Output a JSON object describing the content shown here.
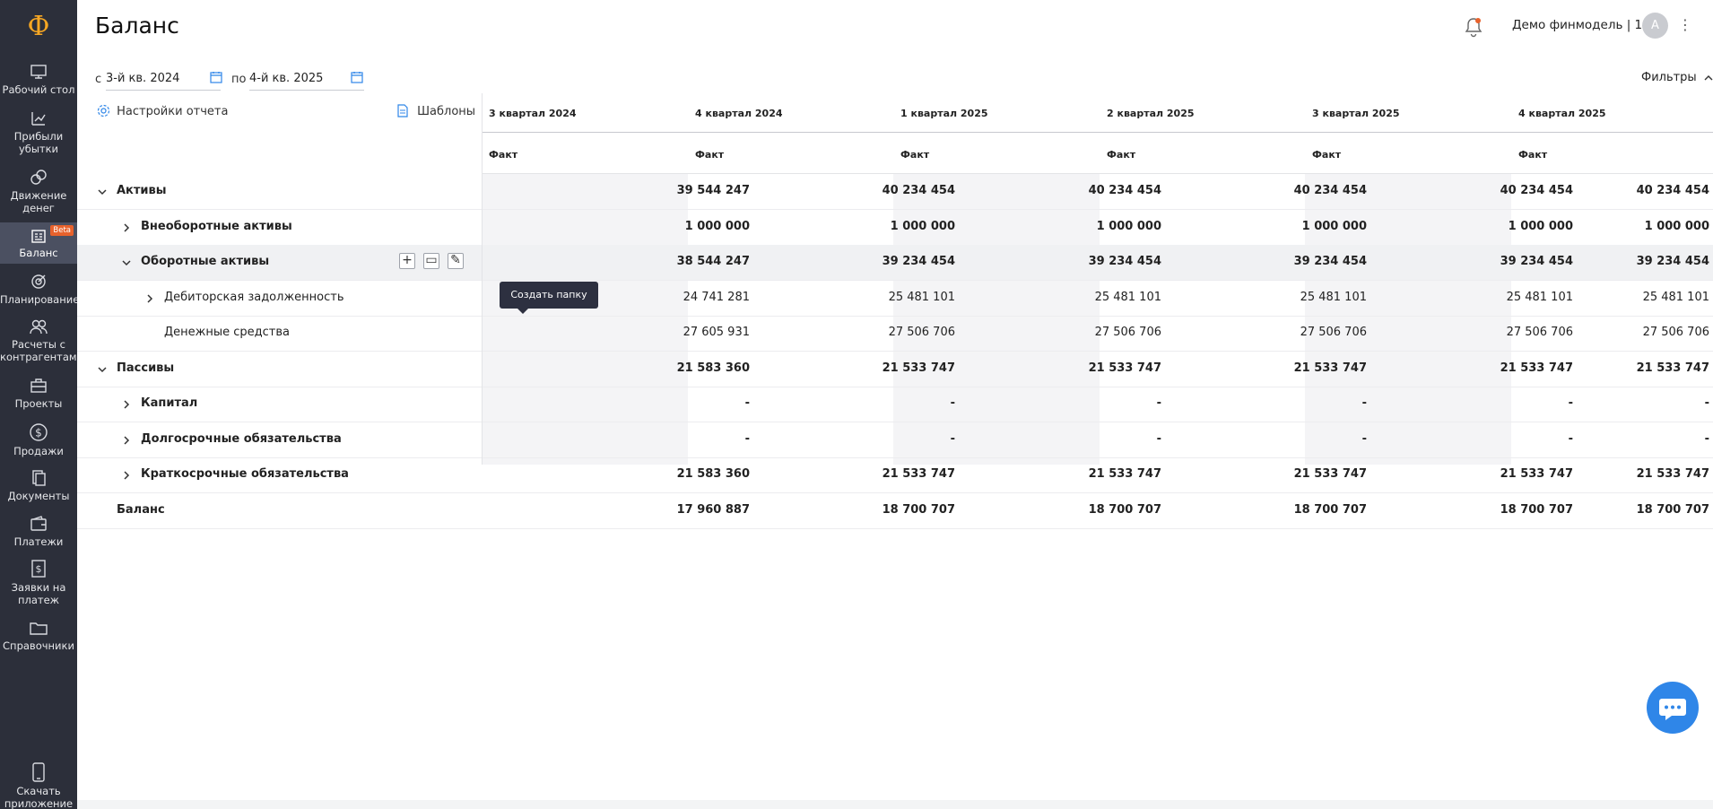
{
  "app": {
    "logo_glyph": "Ф",
    "accent_color": "#f5a623"
  },
  "sidebar": {
    "items": [
      {
        "label": "Рабочий стол",
        "icon": "desktop-icon"
      },
      {
        "label": "Прибыли убытки",
        "icon": "chart-icon"
      },
      {
        "label": "Движение денег",
        "icon": "coins-icon"
      },
      {
        "label": "Баланс",
        "icon": "balance-icon",
        "active": true,
        "badge": "Beta"
      },
      {
        "label": "Планирование",
        "icon": "target-icon"
      },
      {
        "label": "Расчеты с контрагентами",
        "icon": "people-icon"
      },
      {
        "label": "Проекты",
        "icon": "briefcase-icon"
      },
      {
        "label": "Продажи",
        "icon": "dollar-icon"
      },
      {
        "label": "Документы",
        "icon": "documents-icon"
      },
      {
        "label": "Платежи",
        "icon": "wallet-icon"
      },
      {
        "label": "Заявки на платеж",
        "icon": "payment-request-icon"
      },
      {
        "label": "Справочники",
        "icon": "folder-icon"
      }
    ],
    "download": {
      "label": "Скачать приложение",
      "icon": "phone-icon"
    }
  },
  "header": {
    "title": "Баланс",
    "account": "Демо финмодель | 1С",
    "avatar": "А",
    "menu": "⋮"
  },
  "filters": {
    "from_label": "с",
    "from_value": "3-й кв. 2024",
    "to_label": "по",
    "to_value": "4-й кв. 2025",
    "filters_label": "Фильтры"
  },
  "toolbar": {
    "settings_label": "Настройки отчета",
    "templates_label": "Шаблоны"
  },
  "tooltip": "Создать папку",
  "table": {
    "columns": [
      "3 квартал 2024",
      "4 квартал 2024",
      "1 квартал 2025",
      "2 квартал 2025",
      "3 квартал 2025",
      "4 квартал 2025"
    ],
    "subheader": [
      "Факт",
      "Факт",
      "Факт",
      "Факт",
      "Факт",
      "Факт"
    ],
    "rows": [
      {
        "label": "Активы",
        "level": 0,
        "expanded": true,
        "bold": true,
        "values": [
          "39 544 247",
          "40 234 454",
          "40 234 454",
          "40 234 454",
          "40 234 454",
          "40 234 454"
        ]
      },
      {
        "label": "Внеоборотные активы",
        "level": 1,
        "expanded": false,
        "bold": true,
        "values": [
          "1 000 000",
          "1 000 000",
          "1 000 000",
          "1 000 000",
          "1 000 000",
          "1 000 000"
        ]
      },
      {
        "label": "Оборотные активы",
        "level": 1,
        "expanded": true,
        "bold": true,
        "hover": true,
        "values": [
          "38 544 247",
          "39 234 454",
          "39 234 454",
          "39 234 454",
          "39 234 454",
          "39 234 454"
        ]
      },
      {
        "label": "Дебиторская задолженность",
        "level": 2,
        "expanded": false,
        "bold": false,
        "values": [
          "24 741 281",
          "25 481 101",
          "25 481 101",
          "25 481 101",
          "25 481 101",
          "25 481 101"
        ]
      },
      {
        "label": "Денежные средства",
        "level": 2,
        "leaf": true,
        "bold": false,
        "values": [
          "27 605 931",
          "27 506 706",
          "27 506 706",
          "27 506 706",
          "27 506 706",
          "27 506 706"
        ]
      },
      {
        "label": "Пассивы",
        "level": 0,
        "expanded": true,
        "bold": true,
        "values": [
          "21 583 360",
          "21 533 747",
          "21 533 747",
          "21 533 747",
          "21 533 747",
          "21 533 747"
        ]
      },
      {
        "label": "Капитал",
        "level": 1,
        "expanded": false,
        "bold": true,
        "values": [
          "-",
          "-",
          "-",
          "-",
          "-",
          "-"
        ]
      },
      {
        "label": "Долгосрочные обязательства",
        "level": 1,
        "expanded": false,
        "bold": true,
        "values": [
          "-",
          "-",
          "-",
          "-",
          "-",
          "-"
        ]
      },
      {
        "label": "Краткосрочные обязательства",
        "level": 1,
        "expanded": false,
        "bold": true,
        "values": [
          "21 583 360",
          "21 533 747",
          "21 533 747",
          "21 533 747",
          "21 533 747",
          "21 533 747"
        ]
      },
      {
        "label": "Баланс",
        "level": 0,
        "leaf": true,
        "bold": true,
        "values": [
          "17 960 887",
          "18 700 707",
          "18 700 707",
          "18 700 707",
          "18 700 707",
          "18 700 707"
        ]
      }
    ]
  }
}
